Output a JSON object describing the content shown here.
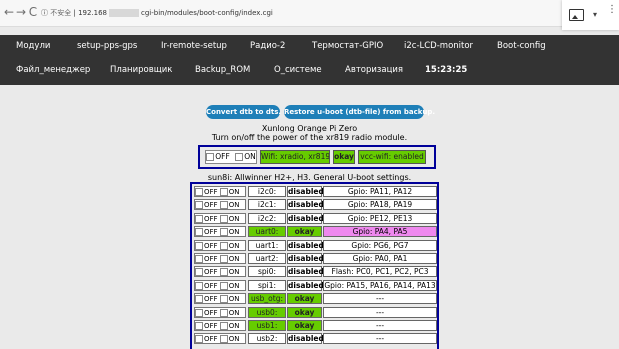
{
  "browser": {
    "back": "←",
    "forward": "→",
    "reload": "C",
    "info": "ⓘ",
    "security": "不安全",
    "separator": "|",
    "host": "192.168",
    "path": "cgi-bin/modules/boot-config/index.cgi",
    "ext_arrow": "▾",
    "ext_dots": "⋮"
  },
  "menu": {
    "row1": [
      "Модули",
      "setup-pps-gps",
      "Ir-remote-setup",
      "Радио-2",
      "Термостат-GPIO",
      "i2c-LCD-monitor",
      "Boot-config"
    ],
    "row2": [
      "Файл_менеджер",
      "Планировщик",
      "Backup_ROM",
      "О_системе",
      "Авторизация"
    ],
    "clock": "15:23:25"
  },
  "actions": {
    "convert": "Convert dtb to dts.",
    "restore": "Restore u-boot (dtb-file) from backup."
  },
  "board": "Xunlong Orange Pi Zero",
  "radio": {
    "caption": "Turn on/off the power of the xr819 radio module.",
    "off_label": "OFF",
    "on_label": "ON",
    "wifi": "Wifi: xradio, xr819",
    "status": "okay",
    "vcc": "vcc-wifi: enabled"
  },
  "uboot_caption": "sun8i: Allwinner H2+, H3. General U-boot settings.",
  "peripherals": {
    "off_label": "OFF",
    "on_label": "ON",
    "rows": [
      {
        "name": "i2c0:",
        "status": "disabled",
        "gpio": "Gpio: PA11, PA12",
        "state": "off"
      },
      {
        "name": "i2c1:",
        "status": "disabled",
        "gpio": "Gpio: PA18, PA19",
        "state": "off"
      },
      {
        "name": "i2c2:",
        "status": "disabled",
        "gpio": "Gpio: PE12, PE13",
        "state": "off"
      },
      {
        "name": "uart0:",
        "status": "okay",
        "gpio": "Gpio: PA4, PA5",
        "state": "on_pink"
      },
      {
        "name": "uart1:",
        "status": "disabled",
        "gpio": "Gpio: PG6, PG7",
        "state": "off"
      },
      {
        "name": "uart2:",
        "status": "disabled",
        "gpio": "Gpio: PA0, PA1",
        "state": "off"
      },
      {
        "name": "spi0:",
        "status": "disabled",
        "gpio": "Flash: PC0, PC1, PC2, PC3",
        "state": "off"
      },
      {
        "name": "spi1:",
        "status": "disabled",
        "gpio": "Gpio: PA15, PA16, PA14, PA13",
        "state": "off"
      },
      {
        "name": "usb_otg:",
        "status": "okay",
        "gpio": "---",
        "state": "on"
      },
      {
        "name": "usb0:",
        "status": "okay",
        "gpio": "---",
        "state": "on"
      },
      {
        "name": "usb1:",
        "status": "okay",
        "gpio": "---",
        "state": "on"
      },
      {
        "name": "usb2:",
        "status": "disabled",
        "gpio": "---",
        "state": "off"
      }
    ]
  }
}
